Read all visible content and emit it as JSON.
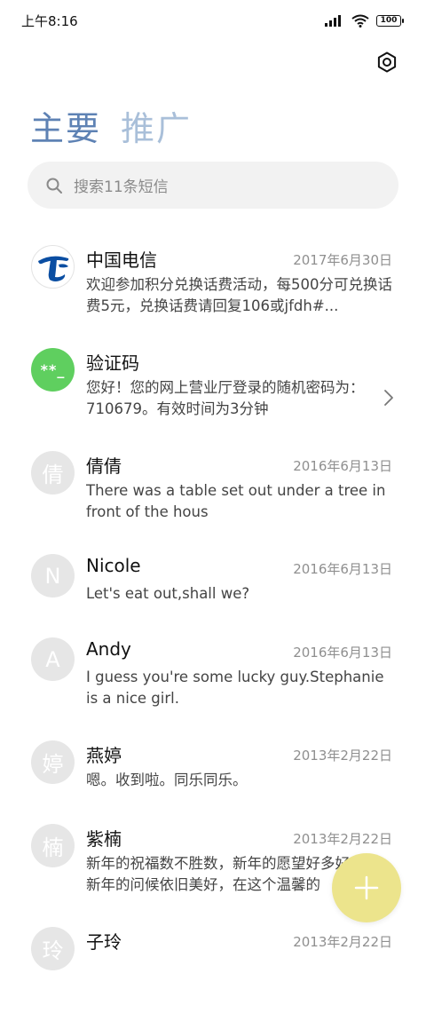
{
  "status_bar": {
    "time": "上午8:16",
    "battery": "100"
  },
  "tabs": [
    {
      "label": "主要",
      "active": true
    },
    {
      "label": "推广",
      "active": false
    }
  ],
  "search": {
    "placeholder": "搜索11条短信"
  },
  "messages": [
    {
      "name": "中国电信",
      "date": "2017年6月30日",
      "preview": "欢迎参加积分兑换话费活动，每500分可兑换话费5元，兑换话费请回复106或jfdh#...",
      "avatar": "china-telecom-logo-icon"
    },
    {
      "name": "验证码",
      "date": "",
      "preview": "您好！您的网上营业厅登录的随机密码为：710679。有效时间为3分钟",
      "avatar_text": "**_"
    },
    {
      "name": "倩倩",
      "date": "2016年6月13日",
      "preview": "There was a table set out under a tree in front of the hous",
      "avatar_text": "倩"
    },
    {
      "name": "Nicole",
      "date": "2016年6月13日",
      "preview": "Let's eat out,shall we?",
      "avatar_text": "N"
    },
    {
      "name": "Andy",
      "date": "2016年6月13日",
      "preview": "I guess you're some lucky guy.Stephanie is a nice girl.",
      "avatar_text": "A"
    },
    {
      "name": "燕婷",
      "date": "2013年2月22日",
      "preview": "嗯。收到啦。同乐同乐。",
      "avatar_text": "婷"
    },
    {
      "name": "紫楠",
      "date": "2013年2月22日",
      "preview": "新年的祝福数不胜数，新年的愿望好多好多，新年的问候依旧美好，在这个温馨的",
      "avatar_text": "楠"
    },
    {
      "name": "子玲",
      "date": "2013年2月22日",
      "preview": "",
      "avatar_text": "玲"
    }
  ],
  "colors": {
    "active_tab": "#5e82b4",
    "inactive_tab": "#a9bfd9",
    "fab": "#ece48c",
    "verification_avatar": "#5fcf5f",
    "telecom_blue": "#0a4ea2"
  }
}
